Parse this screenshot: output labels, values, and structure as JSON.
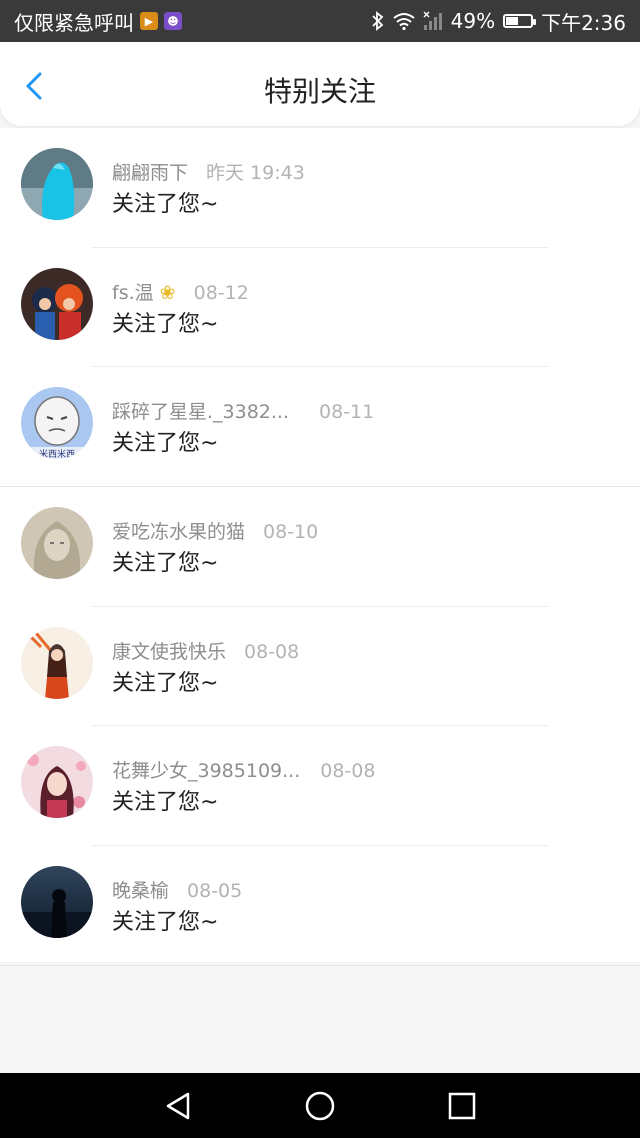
{
  "status_bar": {
    "left_text": "仅限紧急呼叫",
    "battery": "49%",
    "time": "下午2:36",
    "battery_level": 0.49
  },
  "header": {
    "title": "特别关注",
    "back_icon": "chevron-left-icon"
  },
  "items": [
    {
      "name": "翩翩雨下",
      "time": "昨天 19:43",
      "message": "关注了您~"
    },
    {
      "name": "fs.温",
      "time": "08-12",
      "message": "关注了您~"
    },
    {
      "name": "踩碎了星星._3382...",
      "time": "08-11",
      "message": "关注了您~"
    },
    {
      "name": "爱吃冻水果的猫",
      "time": "08-10",
      "message": "关注了您~"
    },
    {
      "name": "康文使我快乐",
      "time": "08-08",
      "message": "关注了您~"
    },
    {
      "name": "花舞少女_3985109...",
      "time": "08-08",
      "message": "关注了您~"
    },
    {
      "name": "晚桑榆",
      "time": "08-05",
      "message": "关注了您~"
    }
  ],
  "avatar_badges": {
    "avatar_3": "米西米西"
  },
  "colors": {
    "accent": "#2196f3",
    "status_bar_bg": "#3a3a3a",
    "nav_bar_bg": "#000000"
  }
}
